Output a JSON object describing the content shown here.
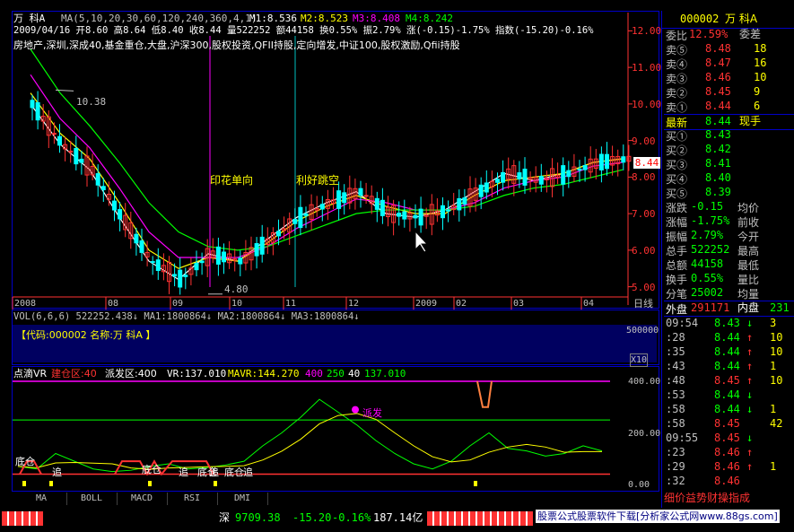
{
  "header": {
    "stock_name": "万  科A",
    "ma_params": "MA(5,10,20,30,60,120,240,360,4,1)",
    "m1": "M1:8.536",
    "m2": "M2:8.523",
    "m3": "M3:8.408",
    "m4": "M4:8.242",
    "ohlc": "2009/04/16 开8.60 高8.64 低8.40 收8.44 量522252 额44158 换0.55% 振2.79% 涨(-0.15)-1.75% 指数(-15.20)-0.16%",
    "sectors": "房地产,深圳,深成40,基金重仓,大盘,沪深300,股权投资,QFII持股,定向增发,中证100,股权激励,Qfii持股"
  },
  "price_chart": {
    "annotation_high": "10.38",
    "annotation_low": "4.80",
    "event_1": "印花单向",
    "event_2": "利好跳空",
    "current_price": "8.44",
    "y_ticks": [
      "12.00",
      "11.00",
      "10.00",
      "9.00",
      "8.00",
      "7.00",
      "6.00",
      "5.00"
    ],
    "x_labels": [
      "2008",
      "08",
      "09",
      "10",
      "11",
      "12",
      "2009",
      "02",
      "03",
      "04"
    ],
    "period": "日线"
  },
  "volume_chart": {
    "legend": "VOL(6,6,6) 522252.438↓ MA1:1800864↓ MA2:1800864↓ MA3:1800864↓",
    "code_label": "【代码:000002 名称:万  科A 】",
    "y_tick": "500000",
    "unit": "X10"
  },
  "indicator_chart": {
    "legend_name": "点滴VR",
    "legend_build": "建仓区:40",
    "legend_dist": "派发区:400",
    "legend_vr": "VR:137.010",
    "legend_mavr": "MAVR:144.270",
    "legend_400": "400",
    "legend_250": "250",
    "legend_40": "40",
    "legend_vr2": "137.010",
    "y_ticks": [
      "400.00",
      "200.00",
      "0.00"
    ],
    "labels": [
      "底仓",
      "追",
      "底仓",
      "追",
      "底仓",
      "追",
      "底仓",
      "追",
      "派发"
    ]
  },
  "bottom_tabs": [
    "MA",
    "BOLL",
    "MACD",
    "RSI",
    "DMI"
  ],
  "quote_panel": {
    "code": "000002",
    "name": "万  科A",
    "weibi_label": "委比",
    "weibi": "12.59%",
    "weicha_label": "委差",
    "sell": [
      {
        "label": "卖⑤",
        "price": "8.48",
        "vol": "18"
      },
      {
        "label": "卖④",
        "price": "8.47",
        "vol": "16"
      },
      {
        "label": "卖③",
        "price": "8.46",
        "vol": "10"
      },
      {
        "label": "卖②",
        "price": "8.45",
        "vol": "9"
      },
      {
        "label": "卖①",
        "price": "8.44",
        "vol": "6"
      }
    ],
    "latest_label": "最新",
    "latest": "8.44",
    "xianshou_label": "现手",
    "buy": [
      {
        "label": "买①",
        "price": "8.43",
        "vol": ""
      },
      {
        "label": "买②",
        "price": "8.42",
        "vol": ""
      },
      {
        "label": "买③",
        "price": "8.41",
        "vol": ""
      },
      {
        "label": "买④",
        "price": "8.40",
        "vol": ""
      },
      {
        "label": "买⑤",
        "price": "8.39",
        "vol": ""
      }
    ],
    "stats": [
      {
        "l1": "涨跌",
        "v1": "-0.15",
        "l2": "均价"
      },
      {
        "l1": "涨幅",
        "v1": "-1.75%",
        "l2": "前收"
      },
      {
        "l1": "振幅",
        "v1": "2.79%",
        "l2": "今开"
      },
      {
        "l1": "总手",
        "v1": "522252",
        "l2": "最高"
      },
      {
        "l1": "总额",
        "v1": "44158",
        "l2": "最低"
      },
      {
        "l1": "换手",
        "v1": "0.55%",
        "l2": "量比"
      },
      {
        "l1": "分笔",
        "v1": "25002",
        "l2": "均量"
      }
    ],
    "waipan_label": "外盘",
    "waipan": "291171",
    "neipan_label": "内盘",
    "neipan": "231",
    "ticks": [
      {
        "time": "09:54",
        "price": "8.43",
        "dir": "↓",
        "vol": "3"
      },
      {
        "time": ":28",
        "price": "8.44",
        "dir": "↑",
        "vol": "10"
      },
      {
        "time": ":35",
        "price": "8.44",
        "dir": "↑",
        "vol": "10"
      },
      {
        "time": ":43",
        "price": "8.44",
        "dir": "↑",
        "vol": "1"
      },
      {
        "time": ":48",
        "price": "8.45",
        "dir": "↑",
        "vol": "10"
      },
      {
        "time": ":53",
        "price": "8.44",
        "dir": "↓",
        "vol": ""
      },
      {
        "time": ":58",
        "price": "8.44",
        "dir": "↓",
        "vol": "1"
      },
      {
        "time": ":58",
        "price": "8.45",
        "dir": "",
        "vol": "42"
      },
      {
        "time": "09:55",
        "price": "8.45",
        "dir": "↓",
        "vol": ""
      },
      {
        "time": ":23",
        "price": "8.46",
        "dir": "↑",
        "vol": ""
      },
      {
        "time": ":29",
        "price": "8.46",
        "dir": "↑",
        "vol": "1"
      },
      {
        "time": ":32",
        "price": "8.46",
        "dir": "",
        "vol": ""
      }
    ],
    "footer_tabs": "细价益势财操指成"
  },
  "status_bar": {
    "index_name": "深",
    "index_value": "9709.38",
    "change": "-15.20",
    "pct": "-0.16%",
    "amount": "187.14亿",
    "ad_text": "股票公式股票软件下载[分析家公式网www.88gs.com]"
  },
  "colors": {
    "up": "#ff3232",
    "down": "#00ffff",
    "frame": "#0000c8",
    "ma1": "#ffffff",
    "ma2": "#ffff00",
    "ma3": "#ff00ff",
    "ma4": "#00ff00"
  },
  "chart_data": {
    "type": "line",
    "title": "万科A 日线",
    "x": [
      "2008",
      "08",
      "09",
      "10",
      "11",
      "12",
      "2009",
      "02",
      "03",
      "04"
    ],
    "ylim": [
      4.5,
      12.5
    ],
    "series": [
      {
        "name": "M1",
        "values": [
          10.0,
          8.9,
          8.2,
          6.9,
          5.7,
          5.2,
          5.9,
          5.7,
          6.3,
          6.9,
          7.3,
          7.6,
          7.0,
          6.9,
          7.1,
          7.6,
          8.1,
          7.9,
          8.1,
          8.4,
          8.5
        ]
      },
      {
        "name": "M2",
        "values": [
          10.3,
          9.2,
          8.5,
          7.3,
          6.0,
          5.5,
          5.8,
          5.7,
          6.2,
          6.8,
          7.2,
          7.5,
          7.2,
          7.0,
          7.0,
          7.5,
          7.9,
          8.0,
          8.1,
          8.4,
          8.5
        ]
      },
      {
        "name": "M3",
        "values": [
          10.8,
          9.6,
          8.8,
          7.7,
          6.5,
          5.8,
          5.8,
          5.8,
          6.1,
          6.6,
          7.0,
          7.4,
          7.3,
          7.1,
          7.1,
          7.3,
          7.7,
          7.9,
          8.0,
          8.3,
          8.4
        ]
      },
      {
        "name": "M4",
        "values": [
          11.5,
          10.3,
          9.4,
          8.4,
          7.3,
          6.5,
          6.1,
          6.0,
          6.1,
          6.4,
          6.7,
          7.0,
          7.1,
          7.1,
          7.1,
          7.2,
          7.5,
          7.7,
          7.8,
          8.0,
          8.2
        ]
      }
    ],
    "annotations": [
      {
        "label": "10.38",
        "value": 10.38
      },
      {
        "label": "4.80",
        "value": 4.8
      },
      {
        "label": "印花单向"
      },
      {
        "label": "利好跳空"
      }
    ]
  }
}
